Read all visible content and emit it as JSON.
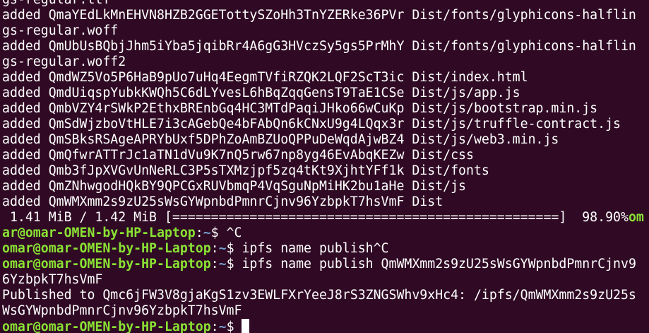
{
  "terminal": {
    "colors": {
      "background": "#300a24",
      "text": "#ffffff",
      "user_host": "#8ae234",
      "path": "#729fcf"
    },
    "lines": [
      {
        "name": "output-line",
        "text": "gs-regular.ttf"
      },
      {
        "name": "output-line",
        "text": "added QmaYEdLkMnEHVN8HZB2GGETottySZoHh3TnYZERke36PVr Dist/fonts/glyphicons-halflin"
      },
      {
        "name": "output-line",
        "text": "gs-regular.woff"
      },
      {
        "name": "output-line",
        "text": "added QmUbUsBQbjJhm5iYba5jqibRr4A6gG3HVczSy5gs5PrMhY Dist/fonts/glyphicons-halflin"
      },
      {
        "name": "output-line",
        "text": "gs-regular.woff2"
      },
      {
        "name": "output-line",
        "text": "added QmdWZ5Vo5P6HaB9pUo7uHq4EegmTVfiRZQK2LQF2ScT3ic Dist/index.html"
      },
      {
        "name": "output-line",
        "text": "added QmdUiqspYubkKWQh5C6dLYvesL6hBqZqqGensT9TaE1CSe Dist/js/app.js"
      },
      {
        "name": "output-line",
        "text": "added QmbVZY4rSWkP2EthxBREnbGq4HC3MTdPaqiJHko66wCuKp Dist/js/bootstrap.min.js"
      },
      {
        "name": "output-line",
        "text": "added QmSdWjzboVtHLE7i3cAGebQe4bFAbQn6kCNxU9g4LQqx3r Dist/js/truffle-contract.js"
      },
      {
        "name": "output-line",
        "text": "added QmSBksRSAgeAPRYbUxf5DPhZoAmBZUoQPPuDeWqdAjwBZ4 Dist/js/web3.min.js"
      },
      {
        "name": "output-line",
        "text": "added QmQfwrATTrJc1aTN1dVu9K7nQ5rw67np8yg46EvAbqKEZw Dist/css"
      },
      {
        "name": "output-line",
        "text": "added Qmb3fJpXVGvUnNeRLC3P5sTXMzjpf5zq4tKt9XjhtYFf1k Dist/fonts"
      },
      {
        "name": "output-line",
        "text": "added QmZNhwgodHQkBY9QPCGxRUVbmqP4VqSguNpMiHK2bu1aHe Dist/js"
      },
      {
        "name": "output-line",
        "text": "added QmWMXmm2s9zU25sWsGYWpnbdPmnrCjnv96YzbpkT7hsVmF Dist"
      },
      {
        "name": "progress-line",
        "text": " 1.41 MiB / 1.42 MiB [==================================================]  98.90%",
        "user_host": "om"
      },
      {
        "name": "prompt-line",
        "user_host": "ar@omar-OMEN-by-HP-Laptop",
        "sep": ":",
        "path": "~",
        "command": "$ ^C"
      },
      {
        "name": "prompt-line",
        "user_host": "omar@omar-OMEN-by-HP-Laptop",
        "sep": ":",
        "path": "~",
        "command": "$ ipfs name publish^C"
      },
      {
        "name": "prompt-line",
        "user_host": "omar@omar-OMEN-by-HP-Laptop",
        "sep": ":",
        "path": "~",
        "command": "$ ipfs name publish QmWMXmm2s9zU25sWsGYWpnbdPmnrCjnv9"
      },
      {
        "name": "output-line",
        "text": "6YzbpkT7hsVmF"
      },
      {
        "name": "output-line",
        "text": "Published to Qmc6jFW3V8gjaKgS1zv3EWLFXrYeeJ8rS3ZNGSWhv9xHc4: /ipfs/QmWMXmm2s9zU25s"
      },
      {
        "name": "output-line",
        "text": "WsGYWpnbdPmnrCjnv96YzbpkT7hsVmF"
      },
      {
        "name": "prompt-line",
        "user_host": "omar@omar-OMEN-by-HP-Laptop",
        "sep": ":",
        "path": "~",
        "command": "$ ",
        "cursor": true
      }
    ]
  }
}
